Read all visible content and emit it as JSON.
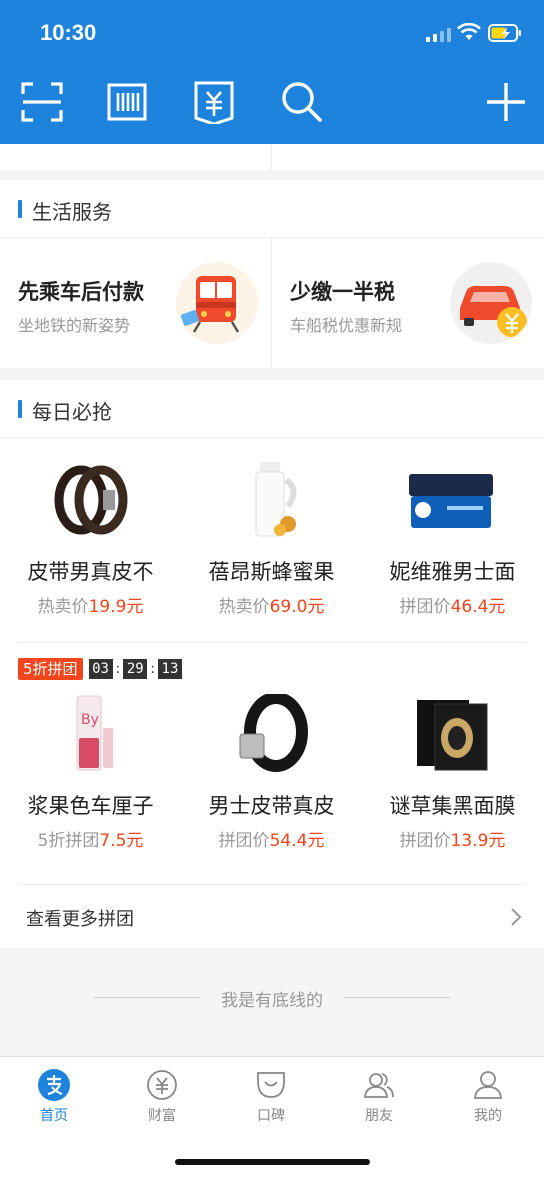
{
  "status": {
    "time": "10:30"
  },
  "toolbar": {
    "icons": [
      "scan-icon",
      "barcode-icon",
      "voucher-icon",
      "search-icon",
      "add-icon"
    ]
  },
  "life_service": {
    "title": "生活服务",
    "items": [
      {
        "title": "先乘车后付款",
        "subtitle": "坐地铁的新姿势",
        "icon": "tram-icon"
      },
      {
        "title": "少缴一半税",
        "subtitle": "车船税优惠新规",
        "icon": "car-tax-icon"
      }
    ]
  },
  "daily_deals": {
    "title": "每日必抢",
    "products_row1": [
      {
        "name": "皮带男真皮不",
        "price_label": "热卖价",
        "price": "19.9元"
      },
      {
        "name": "蓓昂斯蜂蜜果",
        "price_label": "热卖价",
        "price": "69.0元"
      },
      {
        "name": "妮维雅男士面",
        "price_label": "拼团价",
        "price": "46.4元"
      }
    ],
    "group_buy": {
      "tag": "5折拼团",
      "hh": "03",
      "mm": "29",
      "ss": "13"
    },
    "products_row2": [
      {
        "name": "浆果色车厘子",
        "price_label": "5折拼团",
        "price": "7.5元"
      },
      {
        "name": "男士皮带真皮",
        "price_label": "拼团价",
        "price": "54.4元"
      },
      {
        "name": "谜草集黑面膜",
        "price_label": "拼团价",
        "price": "13.9元"
      }
    ],
    "more_label": "查看更多拼团"
  },
  "footer_note": "我是有底线的",
  "tabs": [
    {
      "label": "首页",
      "icon": "alipay-home-icon",
      "active": true
    },
    {
      "label": "财富",
      "icon": "wealth-icon",
      "active": false
    },
    {
      "label": "口碑",
      "icon": "koubei-icon",
      "active": false
    },
    {
      "label": "朋友",
      "icon": "friends-icon",
      "active": false
    },
    {
      "label": "我的",
      "icon": "profile-icon",
      "active": false
    }
  ],
  "colors": {
    "brand": "#1d83dd",
    "price": "#f2441d"
  }
}
